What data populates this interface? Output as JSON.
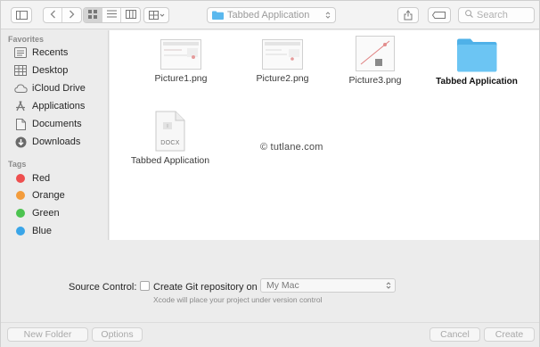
{
  "toolbar": {
    "path_label": "Tabbed Application",
    "search_placeholder": "Search"
  },
  "sidebar": {
    "favorites_heading": "Favorites",
    "favorites": [
      {
        "label": "Recents",
        "icon": "recents-icon"
      },
      {
        "label": "Desktop",
        "icon": "desktop-icon"
      },
      {
        "label": "iCloud Drive",
        "icon": "cloud-icon"
      },
      {
        "label": "Applications",
        "icon": "applications-icon"
      },
      {
        "label": "Documents",
        "icon": "documents-icon"
      },
      {
        "label": "Downloads",
        "icon": "downloads-icon"
      }
    ],
    "tags_heading": "Tags",
    "tags": [
      {
        "label": "Red",
        "color": "#ee4f4f"
      },
      {
        "label": "Orange",
        "color": "#f39c3c"
      },
      {
        "label": "Green",
        "color": "#4cc350"
      },
      {
        "label": "Blue",
        "color": "#3aa5e8"
      }
    ]
  },
  "files": [
    {
      "label": "Picture1.png",
      "kind": "image"
    },
    {
      "label": "Picture2.png",
      "kind": "image"
    },
    {
      "label": "Picture3.png",
      "kind": "image"
    },
    {
      "label": "Tabbed Application",
      "kind": "folder"
    },
    {
      "label": "Tabbed Application",
      "kind": "docx",
      "badge": "DOCX"
    }
  ],
  "watermark": "© tutlane.com",
  "options": {
    "source_control_label": "Source Control:",
    "git_checkbox_label": "Create Git repository on",
    "git_checked": false,
    "location_value": "My Mac",
    "hint": "Xcode will place your project under version control"
  },
  "footer": {
    "new_folder": "New Folder",
    "options": "Options",
    "cancel": "Cancel",
    "create": "Create"
  },
  "colors": {
    "folder_blue": "#6cc5f3",
    "sidebar_bg": "#ececec"
  }
}
